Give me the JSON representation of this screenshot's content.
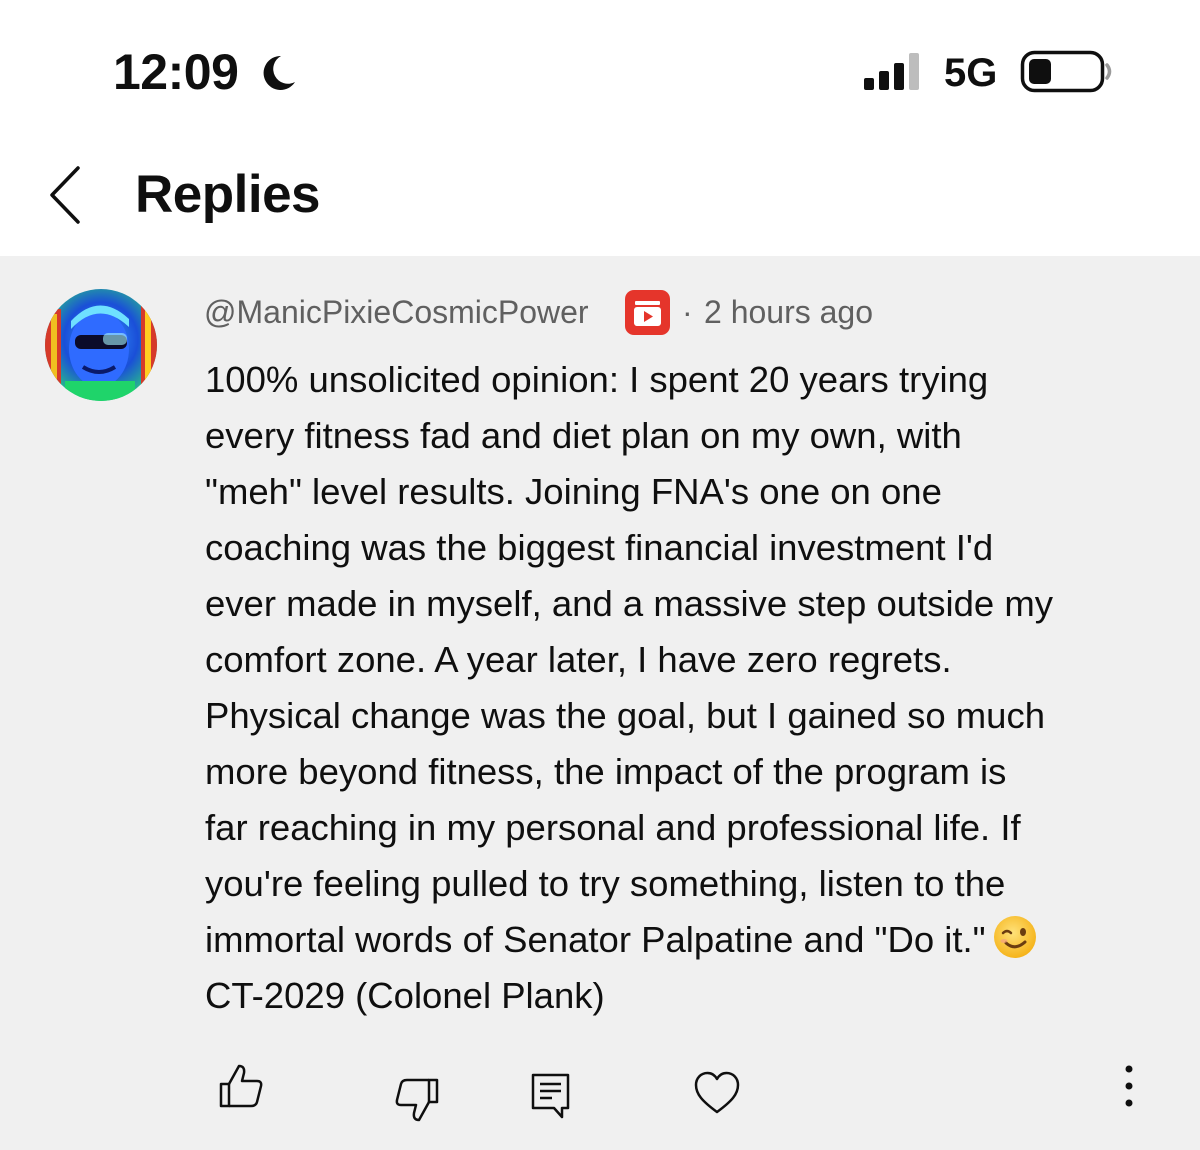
{
  "status_bar": {
    "time": "12:09",
    "network": "5G",
    "icons": [
      "moon-icon",
      "cellular-signal-icon",
      "battery-icon"
    ]
  },
  "header": {
    "title": "Replies",
    "back_icon": "chevron-left-icon"
  },
  "comment": {
    "author": "@ManicPixieCosmicPower",
    "badge_icon": "member-badge-icon",
    "separator": "·",
    "timestamp": "2 hours ago",
    "lines": [
      "100% unsolicited opinion: I spent 20 years trying",
      "every fitness fad and diet plan on my own, with",
      "\"meh\" level results. Joining FNA's one on one",
      "coaching was the biggest financial investment I'd",
      "ever made in myself, and a massive step outside my",
      "comfort zone. A year later, I have zero regrets.",
      "Physical change was the goal, but I gained so much",
      "more beyond fitness, the impact of the program is",
      "far reaching in my personal and professional life. If",
      "you're feeling pulled to try something, listen to the",
      "immortal words of Senator Palpatine and \"Do it.\"",
      "CT-2029 (Colonel Plank)"
    ],
    "emoji": "winking-face-emoji"
  },
  "actions": {
    "icons": [
      "thumbs-up-icon",
      "thumbs-down-icon",
      "reply-icon",
      "heart-icon",
      "more-vertical-icon"
    ]
  },
  "colors": {
    "card_background": "#f0f0f0",
    "secondary_text": "#606060",
    "badge_red": "#e5352b",
    "primary_text": "#0f0f0f"
  }
}
